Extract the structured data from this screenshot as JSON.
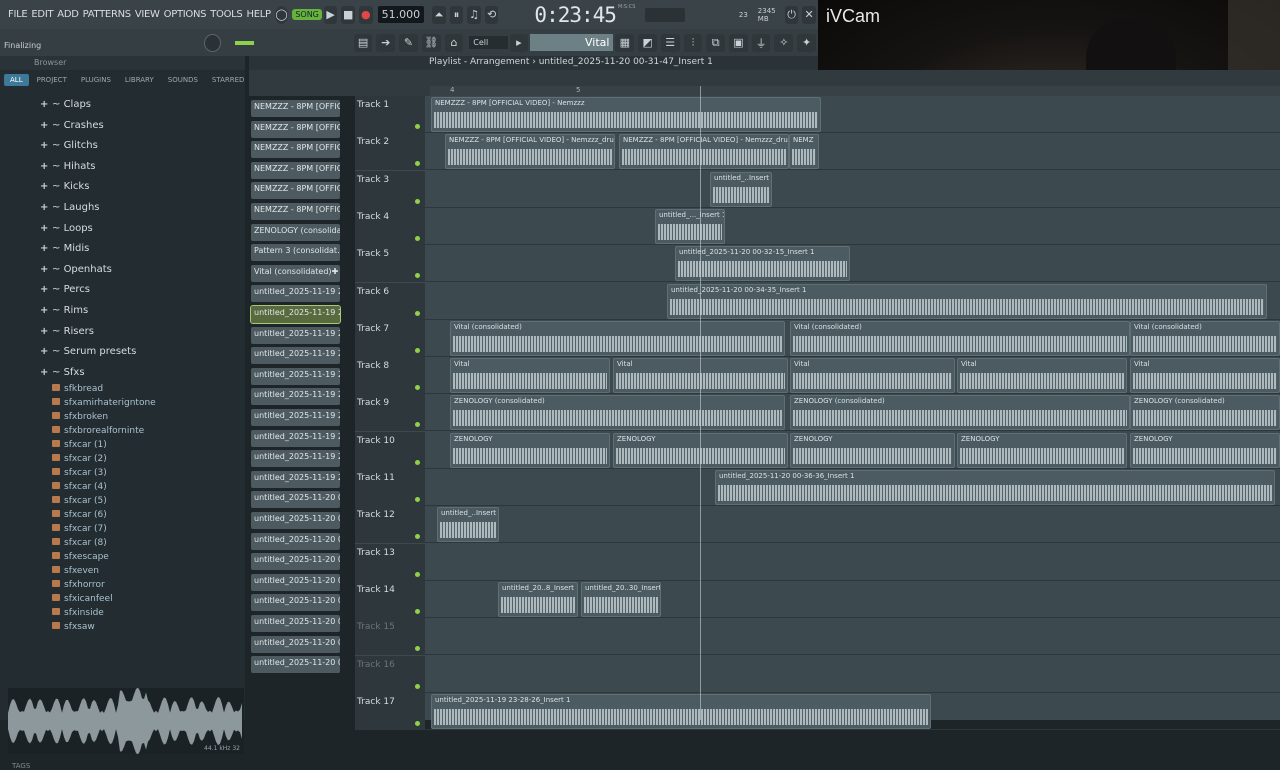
{
  "menu": [
    "FILE",
    "EDIT",
    "ADD",
    "PATTERNS",
    "VIEW",
    "OPTIONS",
    "TOOLS",
    "HELP"
  ],
  "transport": {
    "song_label": "SONG",
    "bpm": "51.000",
    "time": "0:23:45",
    "mode": "M:S:CS",
    "memory": "2345 MB",
    "cpu": "23",
    "voices": "0"
  },
  "toolbar": {
    "snap": "Cell",
    "preset": "Vital"
  },
  "status": "Finalizing",
  "webcam": {
    "title": "iVCam"
  },
  "browser": {
    "title": "Browser",
    "tabs": [
      "ALL",
      "PROJECT",
      "PLUGINS",
      "LIBRARY",
      "SOUNDS",
      "STARRED"
    ],
    "folders": [
      "Claps",
      "Crashes",
      "Glitchs",
      "Hihats",
      "Kicks",
      "Laughs",
      "Loops",
      "Midis",
      "Openhats",
      "Percs",
      "Rims",
      "Risers",
      "Serum presets",
      "Sfxs"
    ],
    "files": [
      "sfkbread",
      "sfxamirhaterigntone",
      "sfxbroken",
      "sfxbrorealforninte",
      "sfxcar (1)",
      "sfxcar (2)",
      "sfxcar (3)",
      "sfxcar (4)",
      "sfxcar (5)",
      "sfxcar (6)",
      "sfxcar (7)",
      "sfxcar (8)",
      "sfxescape",
      "sfxeven",
      "sfxhorror",
      "sfxicanfeel",
      "sfxinside",
      "sfxsaw"
    ],
    "preview_info": "44.1 kHz 32",
    "tags_label": "TAGS"
  },
  "channels": [
    "NEMZZZ - 8PM [OFFIC...",
    "NEMZZZ - 8PM [OFFIC...",
    "NEMZZZ - 8PM [OFFIC...",
    "NEMZZZ - 8PM [OFFIC...",
    "NEMZZZ - 8PM [OFFIC...",
    "NEMZZZ - 8PM [OFFIC...",
    "ZENOLOGY (consolida...",
    "Pattern 3 (consolidat...",
    "Vital (consolidated)",
    "untitled_2025-11-19 23-...",
    "untitled_2025-11-19 23-...",
    "untitled_2025-11-19 23-...",
    "untitled_2025-11-19 23-...",
    "untitled_2025-11-19 23-...",
    "untitled_2025-11-19 23-...",
    "untitled_2025-11-19 23-...",
    "untitled_2025-11-19 23-...",
    "untitled_2025-11-19 23-...",
    "untitled_2025-11-19 23-...",
    "untitled_2025-11-20 00-...",
    "untitled_2025-11-20 00-...",
    "untitled_2025-11-20 00-...",
    "untitled_2025-11-20 00-...",
    "untitled_2025-11-20 00-...",
    "untitled_2025-11-20 00-...",
    "untitled_2025-11-20 00-...",
    "untitled_2025-11-20 00-...",
    "untitled_2025-11-20 00-..."
  ],
  "playlist": {
    "title": "Playlist - Arrangement",
    "pattern": "untitled_2025-11-20 00-31-47_Insert 1",
    "ruler": [
      "4",
      "5"
    ],
    "tracks": [
      "Track 1",
      "Track 2",
      "Track 3",
      "Track 4",
      "Track 5",
      "Track 6",
      "Track 7",
      "Track 8",
      "Track 9",
      "Track 10",
      "Track 11",
      "Track 12",
      "Track 13",
      "Track 14",
      "Track 15",
      "Track 16",
      "Track 17"
    ],
    "clips": {
      "c1": "NEMZZZ - 8PM [OFFICIAL VIDEO] - Nemzzz",
      "c2a": "NEMZZZ - 8PM [OFFICIAL VIDEO] - Nemzzz_drums",
      "c2b": "NEMZZZ - 8PM [OFFICIAL VIDEO] - Nemzzz_drums",
      "c2c": "NEMZ",
      "c3": "untitled_..Insert 1",
      "c4": "untitled_..._Insert 1",
      "c5": "untitled_2025-11-20 00-32-15_Insert 1",
      "c6": "untitled_2025-11-20 00-34-35_Insert 1",
      "c7": "Vital (consolidated)",
      "c8": "Vital",
      "c9": "ZENOLOGY (consolidated)",
      "c10": "ZENOLOGY",
      "c11": "untitled_2025-11-20 00-36-36_Insert 1",
      "c12": "untitled_..Insert 1",
      "c14a": "untitled_20..8_Insert 1",
      "c14b": "untitled_20..30_Insert 1",
      "c17": "untitled_2025-11-19 23-28-26_Insert 1"
    }
  }
}
